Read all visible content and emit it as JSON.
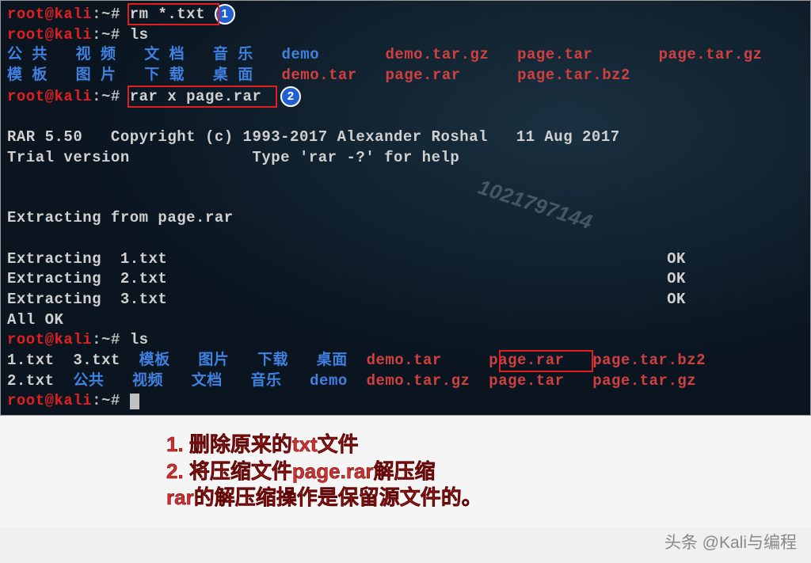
{
  "prompt": {
    "user_host": "root@kali",
    "sep": ":",
    "path": "~",
    "sigil": "#"
  },
  "commands": {
    "rm": "rm *.txt",
    "ls": "ls",
    "rarx": "rar x page.rar"
  },
  "badges": {
    "b1": "1",
    "b2": "2"
  },
  "ls1_dirs_row1": [
    "公 共",
    "视 频",
    "文 档",
    "音 乐",
    "demo"
  ],
  "ls1_arch_row1": [
    "demo.tar.gz",
    "page.tar",
    "page.tar.gz"
  ],
  "ls1_dirs_row2": [
    "模 板",
    "图 片",
    "下 载",
    "桌 面"
  ],
  "ls1_arch_row2": [
    "demo.tar",
    "page.rar",
    "page.tar.bz2"
  ],
  "rar_header1": "RAR 5.50   Copyright (c) 1993-2017 Alexander Roshal   11 Aug 2017",
  "rar_header2": "Trial version             Type 'rar -?' for help",
  "rar_extract_from": "Extracting from page.rar",
  "rar_lines": [
    {
      "label": "Extracting  1.txt",
      "status": "OK"
    },
    {
      "label": "Extracting  2.txt",
      "status": "OK"
    },
    {
      "label": "Extracting  3.txt",
      "status": "OK"
    }
  ],
  "rar_done": "All OK",
  "ls2": {
    "row1": {
      "txt": "1.txt  3.txt",
      "dirs": "模板   图片   下载   桌面",
      "arch": "demo.tar     page.rar   page.tar.bz2"
    },
    "row2": {
      "txt": "2.txt",
      "dirs": "公共   视频   文档   音乐   demo",
      "arch": "demo.tar.gz  page.tar   page.tar.gz"
    }
  },
  "watermark": "1021797144",
  "annotation": {
    "l1": "1. 删除原来的txt文件",
    "l2": "2. 将压缩文件page.rar解压缩",
    "l3": "rar的解压缩操作是保留源文件的。"
  },
  "footer": "头条 @Kali与编程"
}
